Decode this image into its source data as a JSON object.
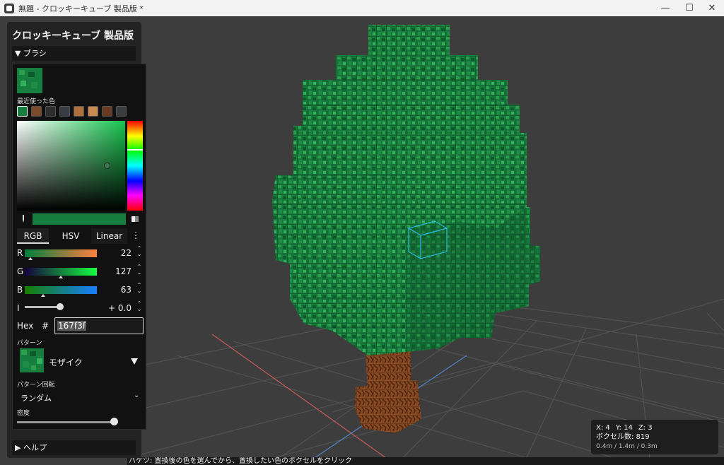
{
  "window": {
    "title": "無題 - クロッキーキューブ 製品版 *",
    "controls": [
      "—",
      "☐",
      "✕"
    ]
  },
  "sidebar": {
    "app_title": "クロッキーキューブ 製品版",
    "brush_section": "▼ ブラシ",
    "help_section": "▶ ヘルプ"
  },
  "color_picker": {
    "recent_label": "最近使った色",
    "recent_colors": [
      "#167f3f",
      "#7a4a2a",
      "#2e2e2e",
      "#383d45",
      "#3a4048",
      "#b0703b",
      "#c88a50",
      "#6a3a22",
      "#3a3d40"
    ],
    "current_color": "#167f3f",
    "tabs": [
      "RGB",
      "HSV",
      "Linear"
    ],
    "more_icon": "⋮",
    "channels": [
      {
        "label": "R",
        "value": "22"
      },
      {
        "label": "G",
        "value": "127"
      },
      {
        "label": "B",
        "value": "63"
      },
      {
        "label": "I",
        "value": "+ 0.0"
      }
    ],
    "hex_label": "Hex",
    "hex_prefix": "#",
    "hex_value": "167f3f",
    "pattern_label": "パターン",
    "pattern_value": "モザイク",
    "rotation_label": "パターン回転",
    "rotation_value": "ランダム",
    "density_label": "密度"
  },
  "status": {
    "coords": {
      "x": "X: 4",
      "y": "Y: 14",
      "z": "Z: 3"
    },
    "voxel_count": "ボクセル数: 819",
    "dimensions": "0.4m / 1.4m / 0.3m",
    "hint": "バケツ: 置換後の色を選んでから、置換したい色のボクセルをクリック"
  }
}
